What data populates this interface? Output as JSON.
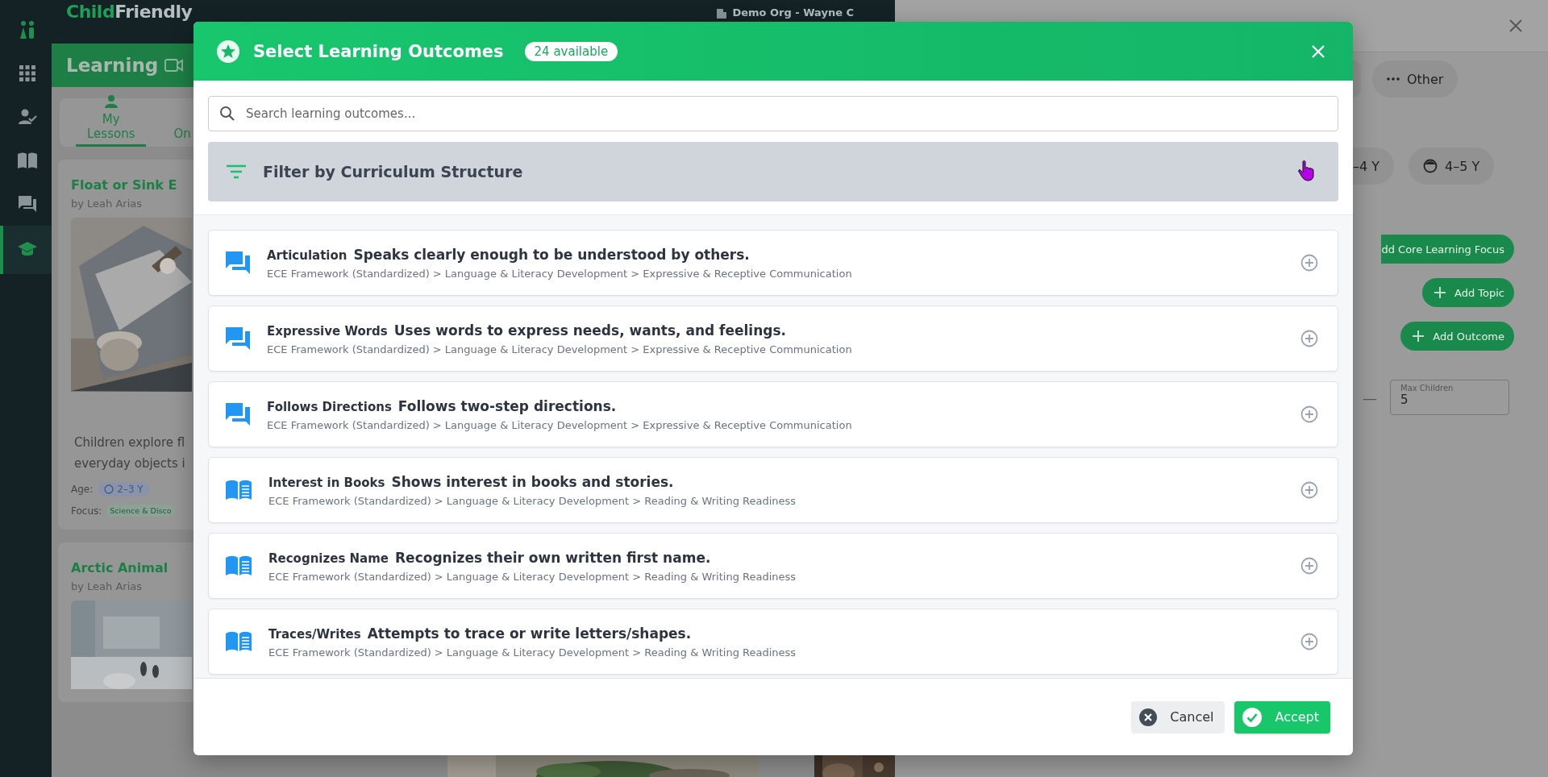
{
  "sidebar": {
    "items": [
      {
        "kind": "family",
        "selected": false
      },
      {
        "kind": "grid",
        "selected": false
      },
      {
        "kind": "person-check",
        "selected": false
      },
      {
        "kind": "book",
        "selected": false
      },
      {
        "kind": "chat",
        "selected": false
      },
      {
        "kind": "graduation",
        "selected": true
      }
    ]
  },
  "topbar": {
    "logo_first": "Child",
    "logo_second": "Friendly",
    "org": "Demo Org - Wayne C"
  },
  "page": {
    "title": "Learning",
    "tabs": [
      {
        "label": "My Lessons",
        "selected": true
      },
      {
        "label": "On",
        "selected": false
      }
    ],
    "lessons": [
      {
        "title": "Float or Sink E",
        "author": "by Leah Arias",
        "description": [
          "Children explore fl",
          "everyday objects i"
        ],
        "age_label": "Age:",
        "age": "2–3 Y",
        "focus_label": "Focus:",
        "focus": "Science & Disco"
      },
      {
        "title": "Arctic Animal",
        "author": "by Leah Arias"
      }
    ]
  },
  "drawer": {
    "other_chip": "Other",
    "age_chips": [
      "–4 Y",
      "4–5 Y"
    ],
    "buttons": [
      {
        "label": "dd Core Learning Focus",
        "plus": false
      },
      {
        "label": "Add Topic",
        "plus": true
      },
      {
        "label": "Add Outcome",
        "plus": true
      }
    ],
    "dash": "—",
    "max_children": {
      "label": "Max Children",
      "value": "5"
    }
  },
  "modal": {
    "title": "Select Learning Outcomes",
    "badge": "24 available",
    "search": {
      "placeholder": "Search learning outcomes..."
    },
    "filter": "Filter by Curriculum Structure",
    "outcomes": [
      {
        "kind": "chat",
        "name": "Articulation",
        "description": "Speaks clearly enough to be understood by others.",
        "path": "ECE Framework (Standardized) > Language & Literacy Development > Expressive & Receptive Communication"
      },
      {
        "kind": "chat",
        "name": "Expressive Words",
        "description": "Uses words to express needs, wants, and feelings.",
        "path": "ECE Framework (Standardized) > Language & Literacy Development > Expressive & Receptive Communication"
      },
      {
        "kind": "chat",
        "name": "Follows Directions",
        "description": "Follows two-step directions.",
        "path": "ECE Framework (Standardized) > Language & Literacy Development > Expressive & Receptive Communication"
      },
      {
        "kind": "book",
        "name": "Interest in Books",
        "description": "Shows interest in books and stories.",
        "path": "ECE Framework (Standardized) > Language & Literacy Development > Reading & Writing Readiness"
      },
      {
        "kind": "book",
        "name": "Recognizes Name",
        "description": "Recognizes their own written first name.",
        "path": "ECE Framework (Standardized) > Language & Literacy Development > Reading & Writing Readiness"
      },
      {
        "kind": "book",
        "name": "Traces/Writes",
        "description": "Attempts to trace or write letters/shapes.",
        "path": "ECE Framework (Standardized) > Language & Literacy Development > Reading & Writing Readiness"
      }
    ],
    "cancel": "Cancel",
    "accept": "Accept"
  }
}
